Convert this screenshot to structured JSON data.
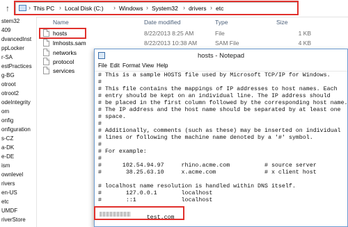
{
  "explorer": {
    "breadcrumb": [
      "This PC",
      "Local Disk (C:)",
      "Windows",
      "System32",
      "drivers",
      "etc"
    ],
    "sidebar": [
      "stem32",
      "409",
      "dvancedInst",
      "ppLocker",
      "r-SA",
      "estPractices",
      "g-BG",
      "otroot",
      "otroot2",
      "odeIntegrity",
      "om",
      "onfig",
      "onfiguration",
      "s-CZ",
      "a-DK",
      "e-DE",
      "ism",
      "ownlevel",
      "rivers",
      "en-US",
      "etc",
      "UMDF",
      "riverStore"
    ],
    "columns": {
      "name": "Name",
      "date": "Date modified",
      "type": "Type",
      "size": "Size"
    },
    "files": [
      {
        "name": "hosts",
        "date": "8/22/2013 8:25 AM",
        "type": "File",
        "size": "1 KB"
      },
      {
        "name": "lmhosts.sam",
        "date": "8/22/2013 10:38 AM",
        "type": "SAM File",
        "size": "4 KB"
      },
      {
        "name": "networks",
        "date": "",
        "type": "",
        "size": ""
      },
      {
        "name": "protocol",
        "date": "",
        "type": "",
        "size": ""
      },
      {
        "name": "services",
        "date": "",
        "type": "",
        "size": ""
      }
    ]
  },
  "notepad": {
    "title": "hosts - Notepad",
    "menu": [
      "File",
      "Edit",
      "Format",
      "View",
      "Help"
    ],
    "lines": [
      "# This is a sample HOSTS file used by Microsoft TCP/IP for Windows.",
      "#",
      "# This file contains the mappings of IP addresses to host names. Each",
      "# entry should be kept on an individual line. The IP address should",
      "# be placed in the first column followed by the corresponding host name.",
      "# The IP address and the host name should be separated by at least one",
      "# space.",
      "#",
      "# Additionally, comments (such as these) may be inserted on individual",
      "# lines or following the machine name denoted by a '#' symbol.",
      "#",
      "# For example:",
      "#",
      "#      102.54.94.97     rhino.acme.com          # source server",
      "#       38.25.63.10     x.acme.com              # x client host",
      "",
      "# localhost name resolution is handled within DNS itself.",
      "#\t127.0.0.1       localhost",
      "#\t::1             localhost",
      "",
      "              test.com"
    ]
  }
}
